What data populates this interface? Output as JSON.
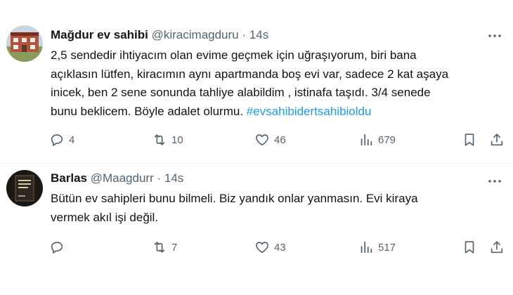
{
  "tweets": [
    {
      "display_name": "Mağdur ev sahibi",
      "handle": "@kiracimagduru",
      "separator": "·",
      "time": "14s",
      "text_lines": [
        "2,5 sendedir ihtiyacım olan evime geçmek için uğraşıyorum, biri bana",
        "açıklasın lütfen, kiracımın aynı apartmanda boş evi var, sadece 2 kat aşaya",
        "inicek, ben 2 sene sonunda tahliye alabildim , istinafa taşıdı. 3/4 senede",
        "bunu beklicem. Böyle adalet olurmu. "
      ],
      "hashtag": "#evsahibidertsahibioldu",
      "replies": "4",
      "retweets": "10",
      "likes": "46",
      "views": "679"
    },
    {
      "display_name": "Barlas",
      "handle": "@Maagdurr",
      "separator": "·",
      "time": "14s",
      "text_lines": [
        "Bütün ev sahipleri bunu bilmeli. Biz yandık onlar yanmasın. Evi kiraya",
        "vermek akıl işi değil."
      ],
      "replies": "",
      "retweets": "7",
      "likes": "43",
      "views": "517"
    }
  ],
  "icons": {
    "reply": "reply-icon",
    "retweet": "retweet-icon",
    "like": "heart-icon",
    "views": "views-chart-icon",
    "bookmark": "bookmark-icon",
    "share": "share-icon",
    "more": "more-icon"
  },
  "colors": {
    "text": "#0f1419",
    "secondary": "#536471",
    "hashtag": "#1d9bf0",
    "divider": "#eff3f4"
  }
}
